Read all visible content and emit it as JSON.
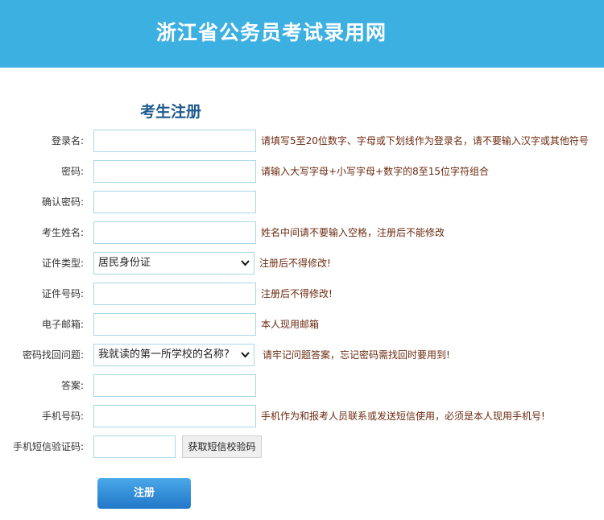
{
  "header": {
    "title": "浙江省公务员考试录用网"
  },
  "form": {
    "title": "考生注册",
    "fields": {
      "username": {
        "label": "登录名:",
        "value": "",
        "hint": "请填写5至20位数字、字母或下划线作为登录名，请不要输入汉字或其他符号"
      },
      "password": {
        "label": "密码:",
        "value": "",
        "hint": "请输入大写字母+小写字母+数字的8至15位字符组合"
      },
      "confirm_password": {
        "label": "确认密码:",
        "value": ""
      },
      "name": {
        "label": "考生姓名:",
        "value": "",
        "hint": "姓名中间请不要输入空格，注册后不能修改"
      },
      "id_type": {
        "label": "证件类型:",
        "selected": "居民身份证",
        "hint": "注册后不得修改!"
      },
      "id_number": {
        "label": "证件号码:",
        "value": "",
        "hint": "注册后不得修改!"
      },
      "email": {
        "label": "电子邮箱:",
        "value": "",
        "hint": "本人现用邮箱"
      },
      "security_question": {
        "label": "密码找回问题:",
        "selected": "我就读的第一所学校的名称?",
        "hint": "请牢记问题答案，忘记密码需找回时要用到!"
      },
      "answer": {
        "label": "答案:",
        "value": ""
      },
      "mobile": {
        "label": "手机号码:",
        "value": "",
        "hint": "手机作为和报考人员联系或发送短信使用，必须是本人现用手机号!"
      },
      "sms_code": {
        "label": "手机短信验证码:",
        "value": "",
        "button": "获取短信校验码"
      }
    },
    "submit_label": "注册"
  },
  "colors": {
    "header_bg": "#3db0e2",
    "title": "#1e5a8e",
    "hint": "#6b2a10",
    "button": "#2a84d6"
  }
}
